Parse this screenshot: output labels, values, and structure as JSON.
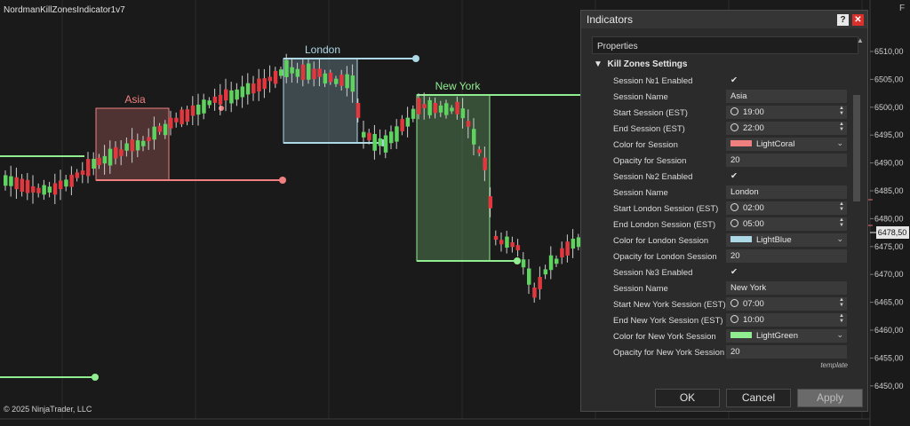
{
  "chart": {
    "title": "NordmanKillZonesIndicator1v7",
    "copyright": "© 2025 NinjaTrader, LLC",
    "panel_letter": "F",
    "current_price_label": "6478,50",
    "price_axis": [
      "6510,00",
      "6505,00",
      "6500,00",
      "6495,00",
      "6490,00",
      "6485,00",
      "6480,00",
      "6475,00",
      "6470,00",
      "6465,00",
      "6460,00",
      "6455,00",
      "6450,00"
    ],
    "zones": [
      {
        "name": "Asia",
        "color": "#f08080"
      },
      {
        "name": "London",
        "color": "#add8e6"
      },
      {
        "name": "New York",
        "color": "#90ee90"
      }
    ]
  },
  "dialog": {
    "title": "Indicators",
    "help_icon": "?",
    "close_icon": "✕",
    "properties_label": "Properties",
    "group_label": "Kill Zones Settings",
    "rows": [
      {
        "label": "Session №1 Enabled",
        "value": "✔",
        "type": "check"
      },
      {
        "label": "Session Name",
        "value": "Asia",
        "type": "text"
      },
      {
        "label": "Start Session (EST)",
        "value": "19:00",
        "type": "time"
      },
      {
        "label": "End Session (EST)",
        "value": "22:00",
        "type": "time"
      },
      {
        "label": "Color for Session",
        "value": "LightCoral",
        "type": "color",
        "color": "#f08080"
      },
      {
        "label": "Opacity for Session",
        "value": "20",
        "type": "text"
      },
      {
        "label": "Session №2 Enabled",
        "value": "✔",
        "type": "check"
      },
      {
        "label": "Session Name",
        "value": "London",
        "type": "text"
      },
      {
        "label": "Start London Session (EST)",
        "value": "02:00",
        "type": "time"
      },
      {
        "label": "End London Session (EST)",
        "value": "05:00",
        "type": "time"
      },
      {
        "label": "Color for London Session",
        "value": "LightBlue",
        "type": "color",
        "color": "#add8e6"
      },
      {
        "label": "Opacity for London Session",
        "value": "20",
        "type": "text"
      },
      {
        "label": "Session №3 Enabled",
        "value": "✔",
        "type": "check"
      },
      {
        "label": "Session Name",
        "value": "New York",
        "type": "text"
      },
      {
        "label": "Start New York Session (EST)",
        "value": "07:00",
        "type": "time"
      },
      {
        "label": "End New York Session (EST)",
        "value": "10:00",
        "type": "time"
      },
      {
        "label": "Color for New York Session",
        "value": "LightGreen",
        "type": "color",
        "color": "#90ee90"
      },
      {
        "label": "Opacity for New York Session",
        "value": "20",
        "type": "text"
      }
    ],
    "template_label": "template",
    "ok_label": "OK",
    "cancel_label": "Cancel",
    "apply_label": "Apply"
  }
}
